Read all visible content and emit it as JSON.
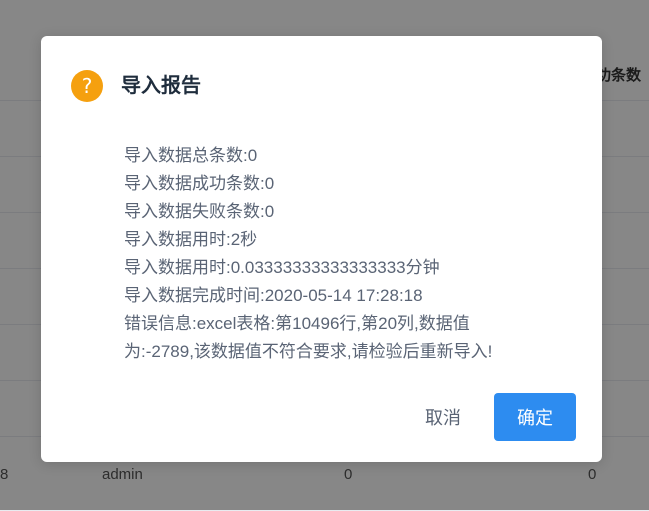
{
  "background": {
    "table_header_partial": "功条数",
    "row": {
      "col_a": "8",
      "col_user": "admin",
      "col_count1": "0",
      "col_count2": "0"
    }
  },
  "dialog": {
    "icon": "question-icon",
    "icon_glyph": "?",
    "title": "导入报告",
    "lines": [
      "导入数据总条数:0",
      "导入数据成功条数:0",
      "导入数据失败条数:0",
      "导入数据用时:2秒",
      "导入数据用时:0.03333333333333333分钟",
      "导入数据完成时间:2020-05-14 17:28:18"
    ],
    "error_line_1": "错误信息:excel表格:第10496行,第20列,数据值",
    "error_line_2": "为:-2789,该数据值不符合要求,请检验后重新导入!",
    "cancel_label": "取消",
    "ok_label": "确定"
  },
  "colors": {
    "icon": "#f5a00f",
    "primary": "#2d8cf0",
    "overlay": "rgba(0,0,0,0.47)"
  }
}
